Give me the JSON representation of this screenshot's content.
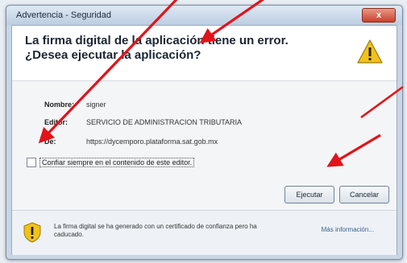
{
  "window": {
    "title": "Advertencia - Seguridad",
    "close_label": "x"
  },
  "header": {
    "headline": "La firma digital de la aplicación tiene un error.  ¿Desea ejecutar la aplicación?"
  },
  "fields": {
    "name_label": "Nombre:",
    "name_value": "signer",
    "editor_label": "Editor:",
    "editor_value": "SERVICIO DE ADMINISTRACION TRIBUTARIA",
    "from_label": "De:",
    "from_value": "https://dycemporo.plataforma.sat.gob.mx"
  },
  "trust_checkbox": {
    "label": "Confiar siempre en el contenido de este editor.",
    "checked": false
  },
  "buttons": {
    "run_label": "Ejecutar",
    "cancel_label": "Cancelar"
  },
  "footer": {
    "message": "La firma digital se ha generado con un certificado de confianza pero ha caducado.",
    "more_info_label": "Más información..."
  },
  "icons": {
    "warning": "warning-triangle-icon",
    "shield": "shield-warning-icon"
  },
  "colors": {
    "arrow": "#e0141a",
    "warning_yellow": "#f2c21a"
  }
}
